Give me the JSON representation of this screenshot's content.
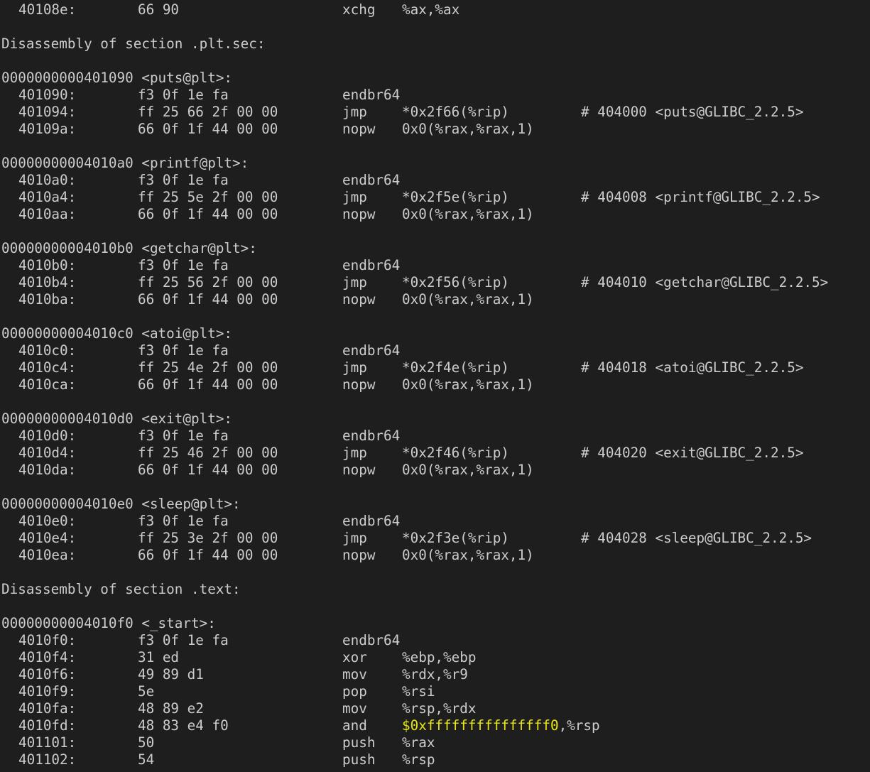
{
  "terminal": {
    "text_color": "#cccccc",
    "background": "#1e1e1e",
    "immediate_color": "#e5e510",
    "lines": [
      {
        "type": "ins",
        "addr": "40108e:",
        "bytes": "66 90",
        "mnem": "xchg",
        "ops": "%ax,%ax",
        "cmt": ""
      },
      {
        "type": "blank"
      },
      {
        "type": "text",
        "text": "Disassembly of section .plt.sec:"
      },
      {
        "type": "blank"
      },
      {
        "type": "text",
        "text": "0000000000401090 <puts@plt>:"
      },
      {
        "type": "ins",
        "addr": "401090:",
        "bytes": "f3 0f 1e fa",
        "mnem": "endbr64",
        "ops": "",
        "cmt": ""
      },
      {
        "type": "ins",
        "addr": "401094:",
        "bytes": "ff 25 66 2f 00 00",
        "mnem": "jmp",
        "ops": "*0x2f66(%rip)",
        "cmt": "# 404000 <puts@GLIBC_2.2.5>"
      },
      {
        "type": "ins",
        "addr": "40109a:",
        "bytes": "66 0f 1f 44 00 00",
        "mnem": "nopw",
        "ops": "0x0(%rax,%rax,1)",
        "cmt": ""
      },
      {
        "type": "blank"
      },
      {
        "type": "text",
        "text": "00000000004010a0 <printf@plt>:"
      },
      {
        "type": "ins",
        "addr": "4010a0:",
        "bytes": "f3 0f 1e fa",
        "mnem": "endbr64",
        "ops": "",
        "cmt": ""
      },
      {
        "type": "ins",
        "addr": "4010a4:",
        "bytes": "ff 25 5e 2f 00 00",
        "mnem": "jmp",
        "ops": "*0x2f5e(%rip)",
        "cmt": "# 404008 <printf@GLIBC_2.2.5>"
      },
      {
        "type": "ins",
        "addr": "4010aa:",
        "bytes": "66 0f 1f 44 00 00",
        "mnem": "nopw",
        "ops": "0x0(%rax,%rax,1)",
        "cmt": ""
      },
      {
        "type": "blank"
      },
      {
        "type": "text",
        "text": "00000000004010b0 <getchar@plt>:"
      },
      {
        "type": "ins",
        "addr": "4010b0:",
        "bytes": "f3 0f 1e fa",
        "mnem": "endbr64",
        "ops": "",
        "cmt": ""
      },
      {
        "type": "ins",
        "addr": "4010b4:",
        "bytes": "ff 25 56 2f 00 00",
        "mnem": "jmp",
        "ops": "*0x2f56(%rip)",
        "cmt": "# 404010 <getchar@GLIBC_2.2.5>"
      },
      {
        "type": "ins",
        "addr": "4010ba:",
        "bytes": "66 0f 1f 44 00 00",
        "mnem": "nopw",
        "ops": "0x0(%rax,%rax,1)",
        "cmt": ""
      },
      {
        "type": "blank"
      },
      {
        "type": "text",
        "text": "00000000004010c0 <atoi@plt>:"
      },
      {
        "type": "ins",
        "addr": "4010c0:",
        "bytes": "f3 0f 1e fa",
        "mnem": "endbr64",
        "ops": "",
        "cmt": ""
      },
      {
        "type": "ins",
        "addr": "4010c4:",
        "bytes": "ff 25 4e 2f 00 00",
        "mnem": "jmp",
        "ops": "*0x2f4e(%rip)",
        "cmt": "# 404018 <atoi@GLIBC_2.2.5>"
      },
      {
        "type": "ins",
        "addr": "4010ca:",
        "bytes": "66 0f 1f 44 00 00",
        "mnem": "nopw",
        "ops": "0x0(%rax,%rax,1)",
        "cmt": ""
      },
      {
        "type": "blank"
      },
      {
        "type": "text",
        "text": "00000000004010d0 <exit@plt>:"
      },
      {
        "type": "ins",
        "addr": "4010d0:",
        "bytes": "f3 0f 1e fa",
        "mnem": "endbr64",
        "ops": "",
        "cmt": ""
      },
      {
        "type": "ins",
        "addr": "4010d4:",
        "bytes": "ff 25 46 2f 00 00",
        "mnem": "jmp",
        "ops": "*0x2f46(%rip)",
        "cmt": "# 404020 <exit@GLIBC_2.2.5>"
      },
      {
        "type": "ins",
        "addr": "4010da:",
        "bytes": "66 0f 1f 44 00 00",
        "mnem": "nopw",
        "ops": "0x0(%rax,%rax,1)",
        "cmt": ""
      },
      {
        "type": "blank"
      },
      {
        "type": "text",
        "text": "00000000004010e0 <sleep@plt>:"
      },
      {
        "type": "ins",
        "addr": "4010e0:",
        "bytes": "f3 0f 1e fa",
        "mnem": "endbr64",
        "ops": "",
        "cmt": ""
      },
      {
        "type": "ins",
        "addr": "4010e4:",
        "bytes": "ff 25 3e 2f 00 00",
        "mnem": "jmp",
        "ops": "*0x2f3e(%rip)",
        "cmt": "# 404028 <sleep@GLIBC_2.2.5>"
      },
      {
        "type": "ins",
        "addr": "4010ea:",
        "bytes": "66 0f 1f 44 00 00",
        "mnem": "nopw",
        "ops": "0x0(%rax,%rax,1)",
        "cmt": ""
      },
      {
        "type": "blank"
      },
      {
        "type": "text",
        "text": "Disassembly of section .text:"
      },
      {
        "type": "blank"
      },
      {
        "type": "text",
        "text": "00000000004010f0 <_start>:"
      },
      {
        "type": "ins",
        "addr": "4010f0:",
        "bytes": "f3 0f 1e fa",
        "mnem": "endbr64",
        "ops": "",
        "cmt": ""
      },
      {
        "type": "ins",
        "addr": "4010f4:",
        "bytes": "31 ed",
        "mnem": "xor",
        "ops": "%ebp,%ebp",
        "cmt": ""
      },
      {
        "type": "ins",
        "addr": "4010f6:",
        "bytes": "49 89 d1",
        "mnem": "mov",
        "ops": "%rdx,%r9",
        "cmt": ""
      },
      {
        "type": "ins",
        "addr": "4010f9:",
        "bytes": "5e",
        "mnem": "pop",
        "ops": "%rsi",
        "cmt": ""
      },
      {
        "type": "ins",
        "addr": "4010fa:",
        "bytes": "48 89 e2",
        "mnem": "mov",
        "ops": "%rsp,%rdx",
        "cmt": ""
      },
      {
        "type": "ins",
        "addr": "4010fd:",
        "bytes": "48 83 e4 f0",
        "mnem": "and",
        "ops": "",
        "imm": "$0xfffffffffffffff0",
        "ops_tail": ",%rsp",
        "cmt": ""
      },
      {
        "type": "ins",
        "addr": "401101:",
        "bytes": "50",
        "mnem": "push",
        "ops": "%rax",
        "cmt": ""
      },
      {
        "type": "ins",
        "addr": "401102:",
        "bytes": "54",
        "mnem": "push",
        "ops": "%rsp",
        "cmt": ""
      }
    ]
  }
}
